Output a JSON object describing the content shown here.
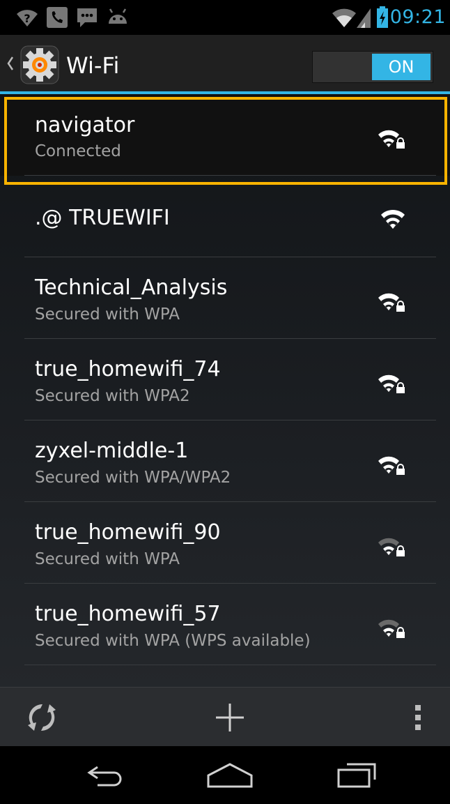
{
  "status_bar": {
    "time": "09:21",
    "left_icons": [
      "wifi-question-icon",
      "phone-icon",
      "chat-icon",
      "android-icon"
    ],
    "right_icons": [
      "wifi-icon",
      "cell-signal-icon",
      "battery-charging-icon"
    ],
    "accent_color": "#33b5e5"
  },
  "action_bar": {
    "title": "Wi-Fi",
    "toggle_label": "ON",
    "accent_color": "#33b5e5"
  },
  "networks": [
    {
      "name": "navigator",
      "status": "Connected",
      "secured": true,
      "signal": "strong",
      "highlighted": true
    },
    {
      "name": ".@ TRUEWIFI",
      "status": "",
      "secured": false,
      "signal": "strong",
      "highlighted": false
    },
    {
      "name": "Technical_Analysis",
      "status": "Secured with WPA",
      "secured": true,
      "signal": "strong",
      "highlighted": false
    },
    {
      "name": "true_homewifi_74",
      "status": "Secured with WPA2",
      "secured": true,
      "signal": "strong",
      "highlighted": false
    },
    {
      "name": "zyxel-middle-1",
      "status": "Secured with WPA/WPA2",
      "secured": true,
      "signal": "strong",
      "highlighted": false
    },
    {
      "name": "true_homewifi_90",
      "status": "Secured with WPA",
      "secured": true,
      "signal": "medium",
      "highlighted": false
    },
    {
      "name": "true_homewifi_57",
      "status": "Secured with WPA (WPS available)",
      "secured": true,
      "signal": "medium",
      "highlighted": false
    }
  ],
  "highlight_color": "#f9b300",
  "bottom_actions": {
    "icons": [
      "wps-icon",
      "add-network-icon",
      "overflow-menu-icon"
    ]
  },
  "nav_bar": {
    "icons": [
      "back-icon",
      "home-icon",
      "recent-apps-icon"
    ]
  }
}
